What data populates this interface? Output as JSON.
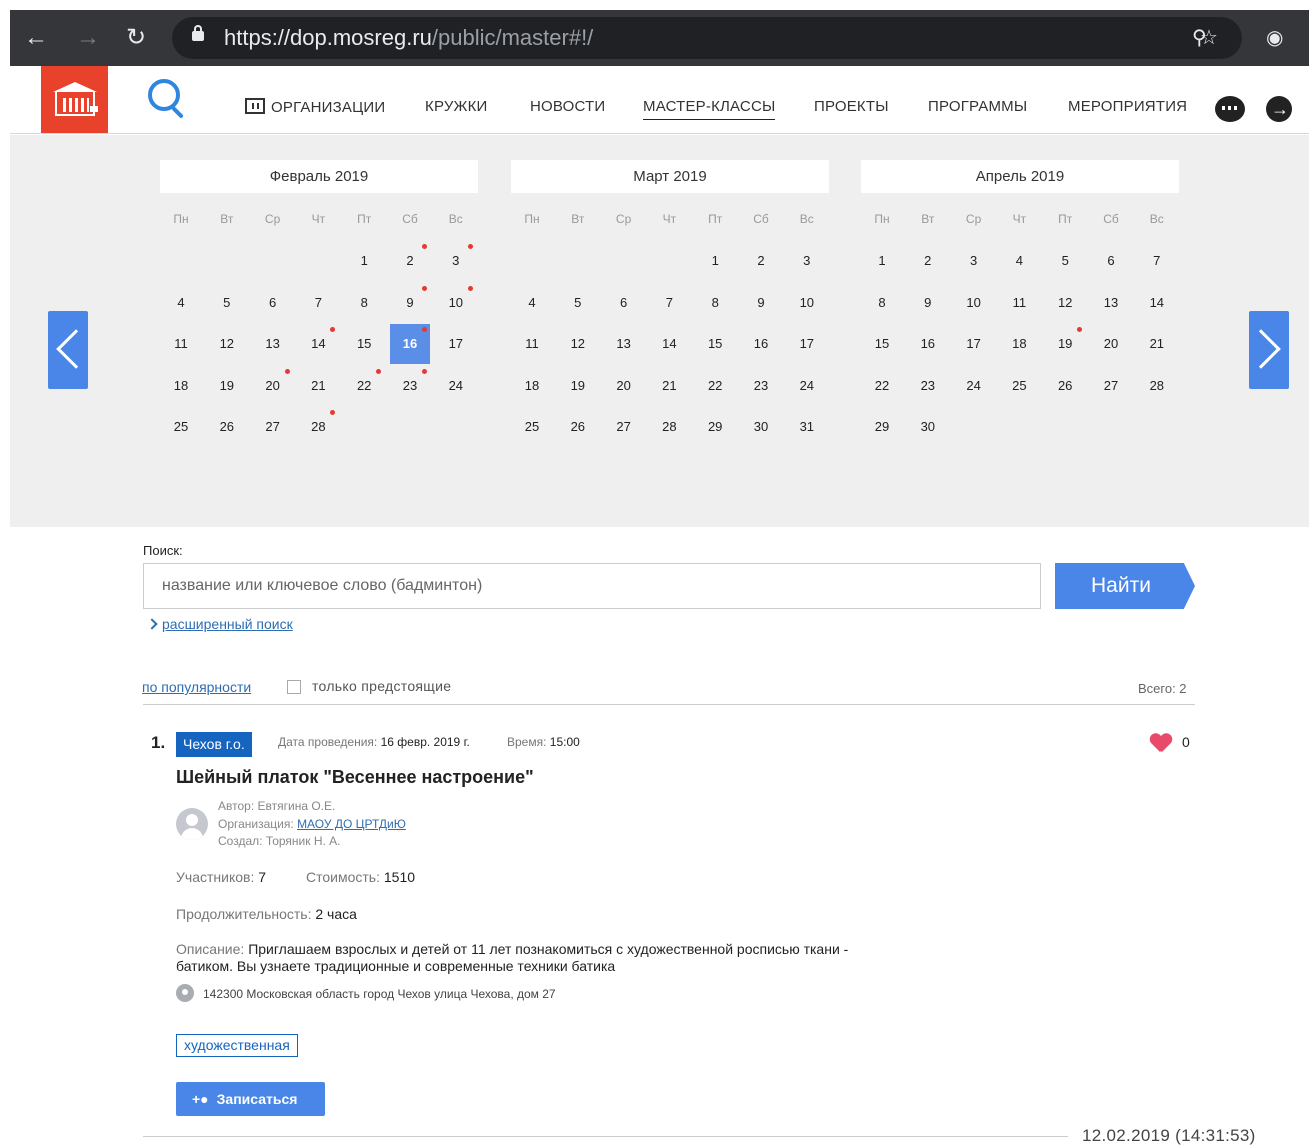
{
  "browser": {
    "url_host": "https://dop.mosreg.ru",
    "url_path": "/public/master#!/",
    "back_icon": "arrow-left-icon",
    "forward_icon": "arrow-right-icon",
    "reload_icon": "reload-icon"
  },
  "header": {
    "menu": [
      {
        "label": "ОРГАНИЗАЦИИ"
      },
      {
        "label": "КРУЖКИ"
      },
      {
        "label": "НОВОСТИ"
      },
      {
        "label": "МАСТЕР-КЛАССЫ",
        "active": true
      },
      {
        "label": "ПРОЕКТЫ"
      },
      {
        "label": "ПРОГРАММЫ"
      },
      {
        "label": "МЕРОПРИЯТИЯ"
      }
    ]
  },
  "calendar": {
    "weekdays": [
      "Пн",
      "Вт",
      "Ср",
      "Чт",
      "Пт",
      "Сб",
      "Вс"
    ],
    "months": [
      {
        "title": "Февраль 2019",
        "first_weekday": 4,
        "days": 28,
        "selected": 16,
        "events": [
          2,
          3,
          9,
          10,
          14,
          16,
          20,
          22,
          23,
          28
        ]
      },
      {
        "title": "Март 2019",
        "first_weekday": 4,
        "days": 31,
        "selected": null,
        "events": []
      },
      {
        "title": "Апрель 2019",
        "first_weekday": 0,
        "days": 30,
        "selected": null,
        "events": [
          19
        ]
      }
    ],
    "accent_color": "#5b8ee6",
    "event_dot_color": "#e53935"
  },
  "search": {
    "label": "Поиск:",
    "placeholder": "название или ключевое слово (бадминтон)",
    "button": "Найти",
    "advanced": "расширенный поиск"
  },
  "filters": {
    "sort": "по популярности",
    "upcoming_only": "только предстоящие",
    "upcoming_checked": false,
    "total": "Всего: 2"
  },
  "results": [
    {
      "index": "1.",
      "region": "Чехов г.о.",
      "date_label": "Дата проведения:",
      "date": "16 февр. 2019 г.",
      "time_label": "Время:",
      "time": "15:00",
      "likes": "0",
      "title": "Шейный платок \"Весеннее настроение\"",
      "author_label": "Автор:",
      "author": "Евтягина О.Е.",
      "org_label": "Организация:",
      "org": "МАОУ ДО ЦРТДиЮ",
      "creator_label": "Создал:",
      "creator": "Торяник Н. А.",
      "participants_label": "Участников:",
      "participants": "7",
      "cost_label": "Стоимость:",
      "cost": "1510",
      "duration_label": "Продолжительность:",
      "duration": "2 часа",
      "description_label": "Описание:",
      "description": "Приглашаем взрослых и детей от 11 лет познакомиться с художественной росписью ткани - батиком. Вы узнаете традиционные и современные техники батика",
      "address": "142300 Московская область город Чехов улица Чехова, дом 27",
      "tag": "художественная",
      "signup": "Записаться",
      "created": "12.02.2019 (14:31:53)"
    }
  ]
}
